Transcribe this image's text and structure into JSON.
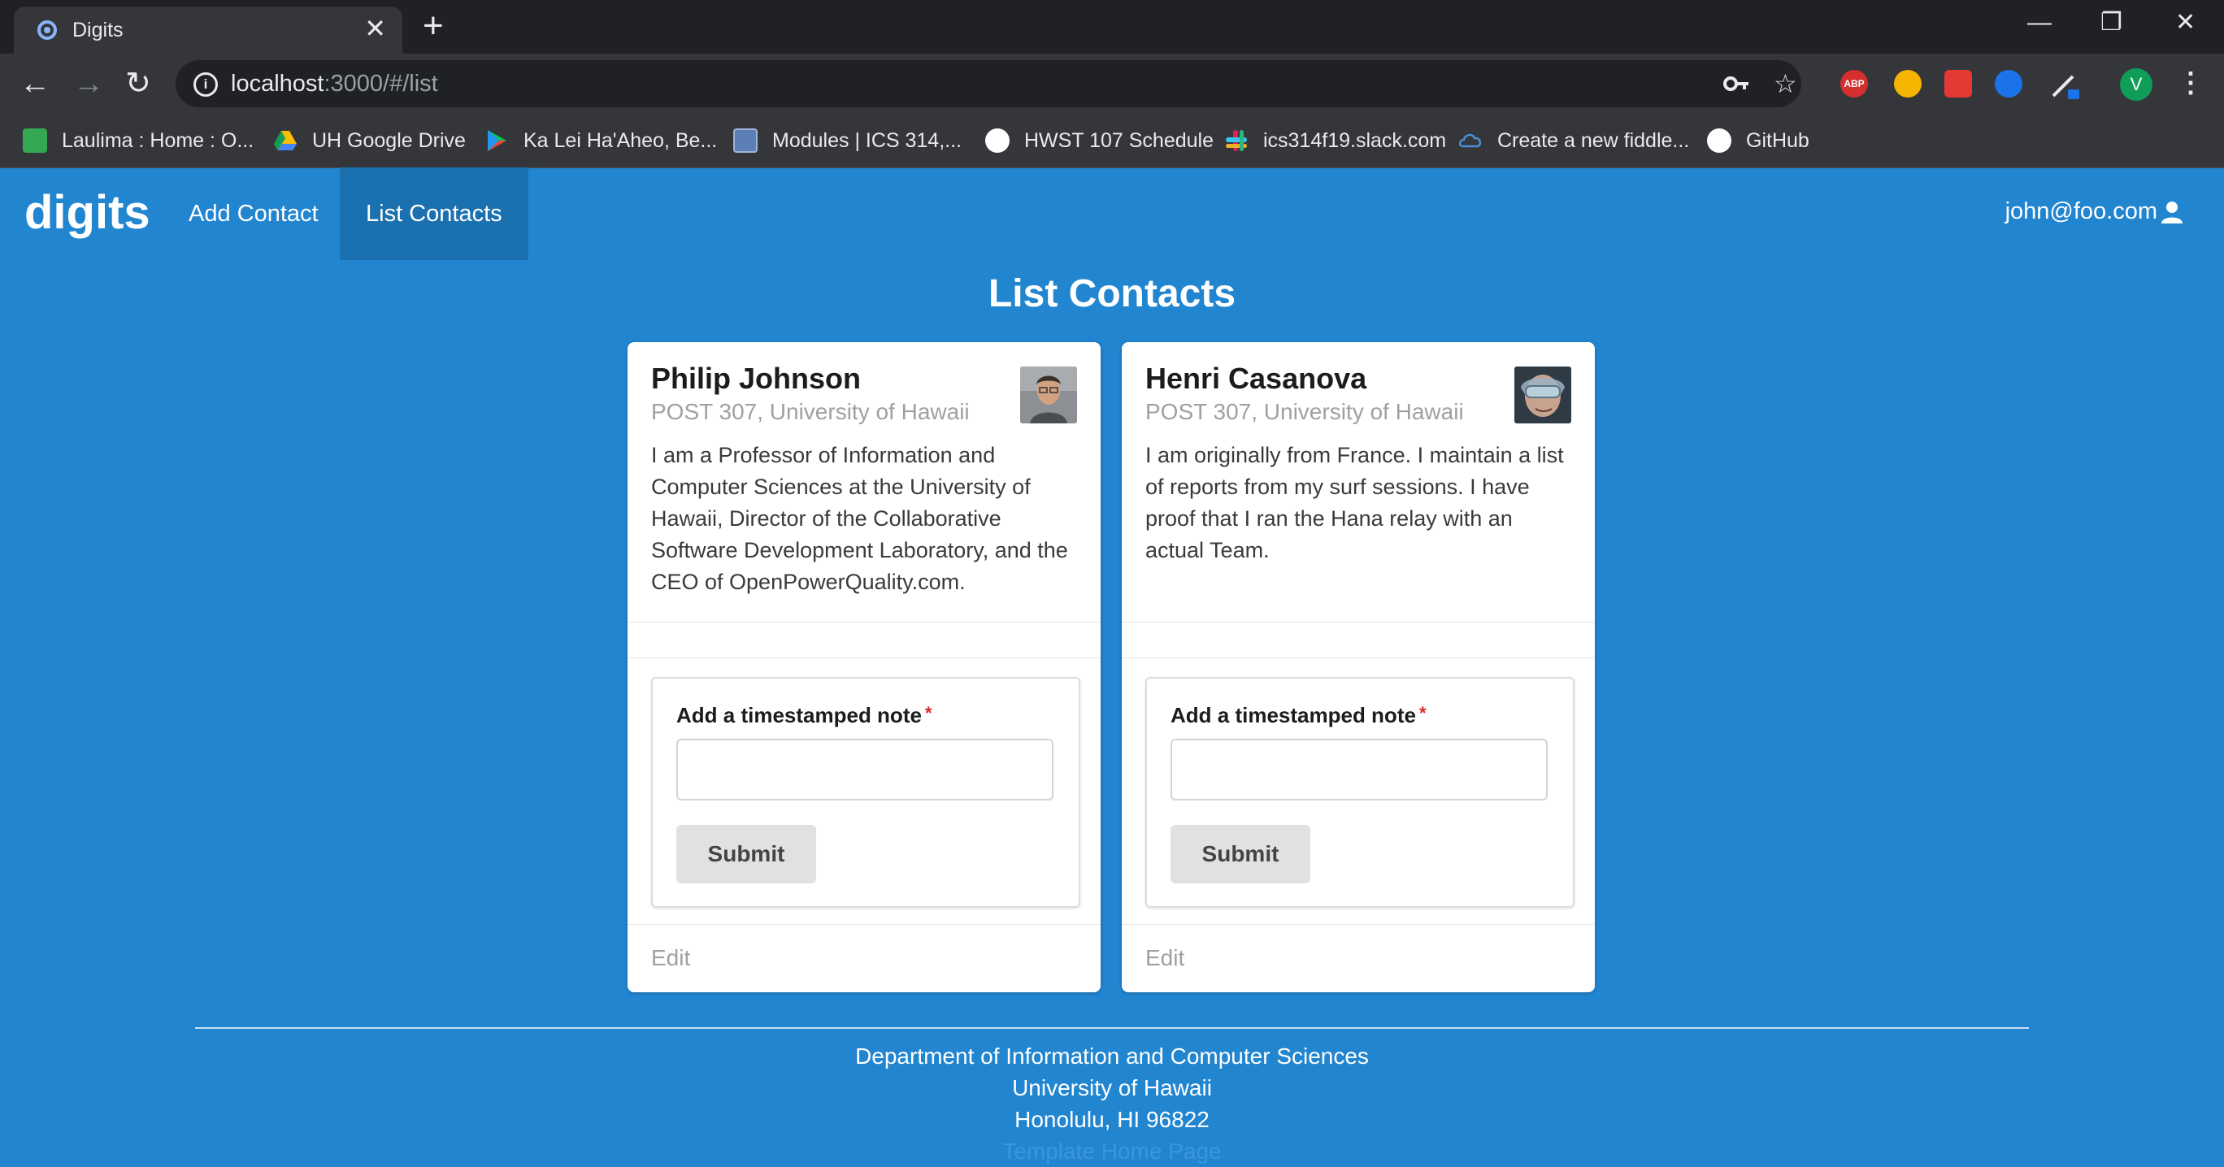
{
  "browser": {
    "tab_title": "Digits",
    "url_host": "localhost",
    "url_rest": ":3000/#/list",
    "window_controls": [
      "minimize",
      "restore",
      "close"
    ],
    "extensions": [
      {
        "name": "adblock-plus",
        "label": "ABP",
        "color": "#d32f2f"
      },
      {
        "name": "chrome-extension-1",
        "label": "",
        "color": "#f4b400"
      },
      {
        "name": "chrome-extension-2",
        "label": "",
        "color": "#e53935"
      },
      {
        "name": "chrome-extension-3",
        "label": "",
        "color": "#1a73e8"
      }
    ],
    "profile_initial": "V",
    "bookmarks": [
      {
        "label": "Laulima : Home : O...",
        "icon": "laulima-icon",
        "color": "#34a853"
      },
      {
        "label": "UH Google Drive",
        "icon": "google-drive-icon",
        "color": "#fbbc04"
      },
      {
        "label": "Ka Lei Ha'Aheo, Be...",
        "icon": "google-play-icon",
        "color": "#00c853"
      },
      {
        "label": "Modules | ICS 314,...",
        "icon": "modules-icon",
        "color": "#5c7fb8"
      },
      {
        "label": "HWST 107 Schedule",
        "icon": "globe-icon",
        "color": "#ffffff"
      },
      {
        "label": "ics314f19.slack.com",
        "icon": "slack-icon",
        "color": "#e01e5a"
      },
      {
        "label": "Create a new fiddle...",
        "icon": "jsfiddle-icon",
        "color": "#4a90d9"
      },
      {
        "label": "GitHub",
        "icon": "github-icon",
        "color": "#ffffff"
      }
    ]
  },
  "app": {
    "brand": "digits",
    "nav": [
      {
        "label": "Add Contact",
        "active": false
      },
      {
        "label": "List Contacts",
        "active": true
      }
    ],
    "user": "john@foo.com"
  },
  "page": {
    "title": "List Contacts"
  },
  "contacts": [
    {
      "name": "Philip Johnson",
      "address": "POST 307, University of Hawaii",
      "description": "I am a Professor of Information and Computer Sciences at the University of Hawaii, Director of the Collaborative Software Development Laboratory, and the CEO of OpenPowerQuality.com.",
      "note_label": "Add a timestamped note",
      "required_marker": "*",
      "submit_label": "Submit",
      "edit_label": "Edit"
    },
    {
      "name": "Henri Casanova",
      "address": "POST 307, University of Hawaii",
      "description": "I am originally from France. I maintain a list of reports from my surf sessions. I have proof that I ran the Hana relay with an actual Team.",
      "note_label": "Add a timestamped note",
      "required_marker": "*",
      "submit_label": "Submit",
      "edit_label": "Edit"
    }
  ],
  "footer": {
    "lines": [
      "Department of Information and Computer Sciences",
      "University of Hawaii",
      "Honolulu, HI 96822"
    ],
    "link": "Template Home Page"
  },
  "colors": {
    "accent": "#2185d0",
    "nav_active": "#1b70b0",
    "button_bg": "#e0e1e2",
    "required": "#db2828"
  }
}
